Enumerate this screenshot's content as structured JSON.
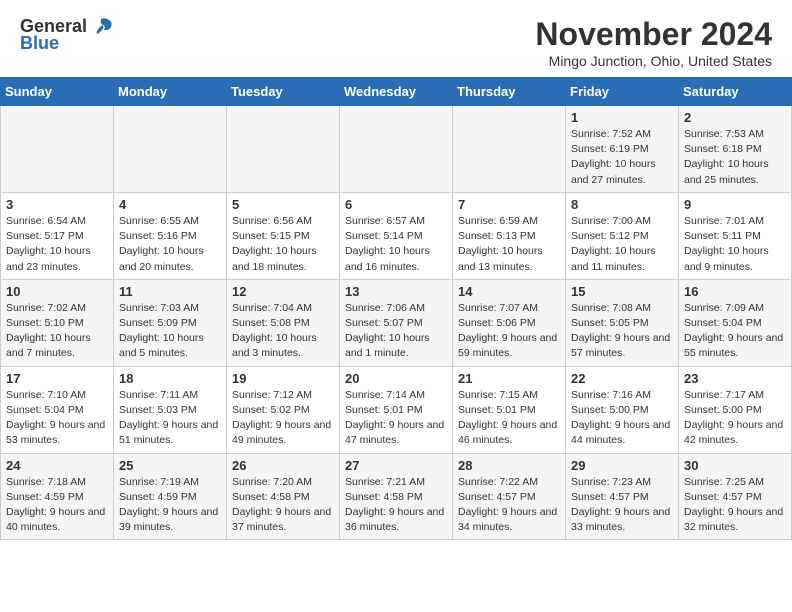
{
  "header": {
    "logo_general": "General",
    "logo_blue": "Blue",
    "month_title": "November 2024",
    "location": "Mingo Junction, Ohio, United States"
  },
  "weekdays": [
    "Sunday",
    "Monday",
    "Tuesday",
    "Wednesday",
    "Thursday",
    "Friday",
    "Saturday"
  ],
  "weeks": [
    [
      {
        "day": "",
        "info": ""
      },
      {
        "day": "",
        "info": ""
      },
      {
        "day": "",
        "info": ""
      },
      {
        "day": "",
        "info": ""
      },
      {
        "day": "",
        "info": ""
      },
      {
        "day": "1",
        "info": "Sunrise: 7:52 AM\nSunset: 6:19 PM\nDaylight: 10 hours and 27 minutes."
      },
      {
        "day": "2",
        "info": "Sunrise: 7:53 AM\nSunset: 6:18 PM\nDaylight: 10 hours and 25 minutes."
      }
    ],
    [
      {
        "day": "3",
        "info": "Sunrise: 6:54 AM\nSunset: 5:17 PM\nDaylight: 10 hours and 23 minutes."
      },
      {
        "day": "4",
        "info": "Sunrise: 6:55 AM\nSunset: 5:16 PM\nDaylight: 10 hours and 20 minutes."
      },
      {
        "day": "5",
        "info": "Sunrise: 6:56 AM\nSunset: 5:15 PM\nDaylight: 10 hours and 18 minutes."
      },
      {
        "day": "6",
        "info": "Sunrise: 6:57 AM\nSunset: 5:14 PM\nDaylight: 10 hours and 16 minutes."
      },
      {
        "day": "7",
        "info": "Sunrise: 6:59 AM\nSunset: 5:13 PM\nDaylight: 10 hours and 13 minutes."
      },
      {
        "day": "8",
        "info": "Sunrise: 7:00 AM\nSunset: 5:12 PM\nDaylight: 10 hours and 11 minutes."
      },
      {
        "day": "9",
        "info": "Sunrise: 7:01 AM\nSunset: 5:11 PM\nDaylight: 10 hours and 9 minutes."
      }
    ],
    [
      {
        "day": "10",
        "info": "Sunrise: 7:02 AM\nSunset: 5:10 PM\nDaylight: 10 hours and 7 minutes."
      },
      {
        "day": "11",
        "info": "Sunrise: 7:03 AM\nSunset: 5:09 PM\nDaylight: 10 hours and 5 minutes."
      },
      {
        "day": "12",
        "info": "Sunrise: 7:04 AM\nSunset: 5:08 PM\nDaylight: 10 hours and 3 minutes."
      },
      {
        "day": "13",
        "info": "Sunrise: 7:06 AM\nSunset: 5:07 PM\nDaylight: 10 hours and 1 minute."
      },
      {
        "day": "14",
        "info": "Sunrise: 7:07 AM\nSunset: 5:06 PM\nDaylight: 9 hours and 59 minutes."
      },
      {
        "day": "15",
        "info": "Sunrise: 7:08 AM\nSunset: 5:05 PM\nDaylight: 9 hours and 57 minutes."
      },
      {
        "day": "16",
        "info": "Sunrise: 7:09 AM\nSunset: 5:04 PM\nDaylight: 9 hours and 55 minutes."
      }
    ],
    [
      {
        "day": "17",
        "info": "Sunrise: 7:10 AM\nSunset: 5:04 PM\nDaylight: 9 hours and 53 minutes."
      },
      {
        "day": "18",
        "info": "Sunrise: 7:11 AM\nSunset: 5:03 PM\nDaylight: 9 hours and 51 minutes."
      },
      {
        "day": "19",
        "info": "Sunrise: 7:12 AM\nSunset: 5:02 PM\nDaylight: 9 hours and 49 minutes."
      },
      {
        "day": "20",
        "info": "Sunrise: 7:14 AM\nSunset: 5:01 PM\nDaylight: 9 hours and 47 minutes."
      },
      {
        "day": "21",
        "info": "Sunrise: 7:15 AM\nSunset: 5:01 PM\nDaylight: 9 hours and 46 minutes."
      },
      {
        "day": "22",
        "info": "Sunrise: 7:16 AM\nSunset: 5:00 PM\nDaylight: 9 hours and 44 minutes."
      },
      {
        "day": "23",
        "info": "Sunrise: 7:17 AM\nSunset: 5:00 PM\nDaylight: 9 hours and 42 minutes."
      }
    ],
    [
      {
        "day": "24",
        "info": "Sunrise: 7:18 AM\nSunset: 4:59 PM\nDaylight: 9 hours and 40 minutes."
      },
      {
        "day": "25",
        "info": "Sunrise: 7:19 AM\nSunset: 4:59 PM\nDaylight: 9 hours and 39 minutes."
      },
      {
        "day": "26",
        "info": "Sunrise: 7:20 AM\nSunset: 4:58 PM\nDaylight: 9 hours and 37 minutes."
      },
      {
        "day": "27",
        "info": "Sunrise: 7:21 AM\nSunset: 4:58 PM\nDaylight: 9 hours and 36 minutes."
      },
      {
        "day": "28",
        "info": "Sunrise: 7:22 AM\nSunset: 4:57 PM\nDaylight: 9 hours and 34 minutes."
      },
      {
        "day": "29",
        "info": "Sunrise: 7:23 AM\nSunset: 4:57 PM\nDaylight: 9 hours and 33 minutes."
      },
      {
        "day": "30",
        "info": "Sunrise: 7:25 AM\nSunset: 4:57 PM\nDaylight: 9 hours and 32 minutes."
      }
    ]
  ]
}
